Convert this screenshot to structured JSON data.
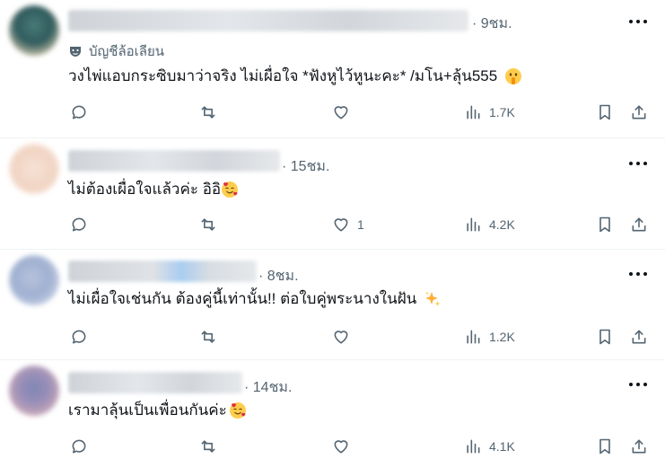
{
  "tweets": [
    {
      "time": "· 9ชม.",
      "badge_icon": "mask-icon",
      "badge_label": "บัญชีล้อเลียน",
      "text": "วงไพ่แอบกระซิบมาว่าจริง ไม่เผื่อใจ *ฟังหูไว้หูนะคะ* /มโน+ลุ้น555",
      "emoji": "shushing-face-emoji",
      "likes": "",
      "views": "1.7K"
    },
    {
      "time": "· 15ชม.",
      "text": "ไม่ต้องเผื่อใจแล้วค่ะ อิอิ",
      "emoji": "smiling-face-with-hearts-emoji",
      "likes": "1",
      "views": "4.2K"
    },
    {
      "time": "· 8ชม.",
      "text": "ไม่เผื่อใจเช่นกัน ต้องคู่นี้เท่านั้น!!  ต่อใบคู่พระนางในฝัน",
      "emoji": "sparkles-emoji",
      "likes": "",
      "views": "1.2K"
    },
    {
      "time": "· 14ชม.",
      "text": "เรามาลุ้นเป็นเพื่อนกันค่ะ",
      "emoji": "smiling-face-with-hearts-emoji",
      "likes": "",
      "views": "4.1K"
    }
  ],
  "colors": {
    "text": "#0f1419",
    "secondary": "#536471",
    "divider": "#eff3f4"
  }
}
